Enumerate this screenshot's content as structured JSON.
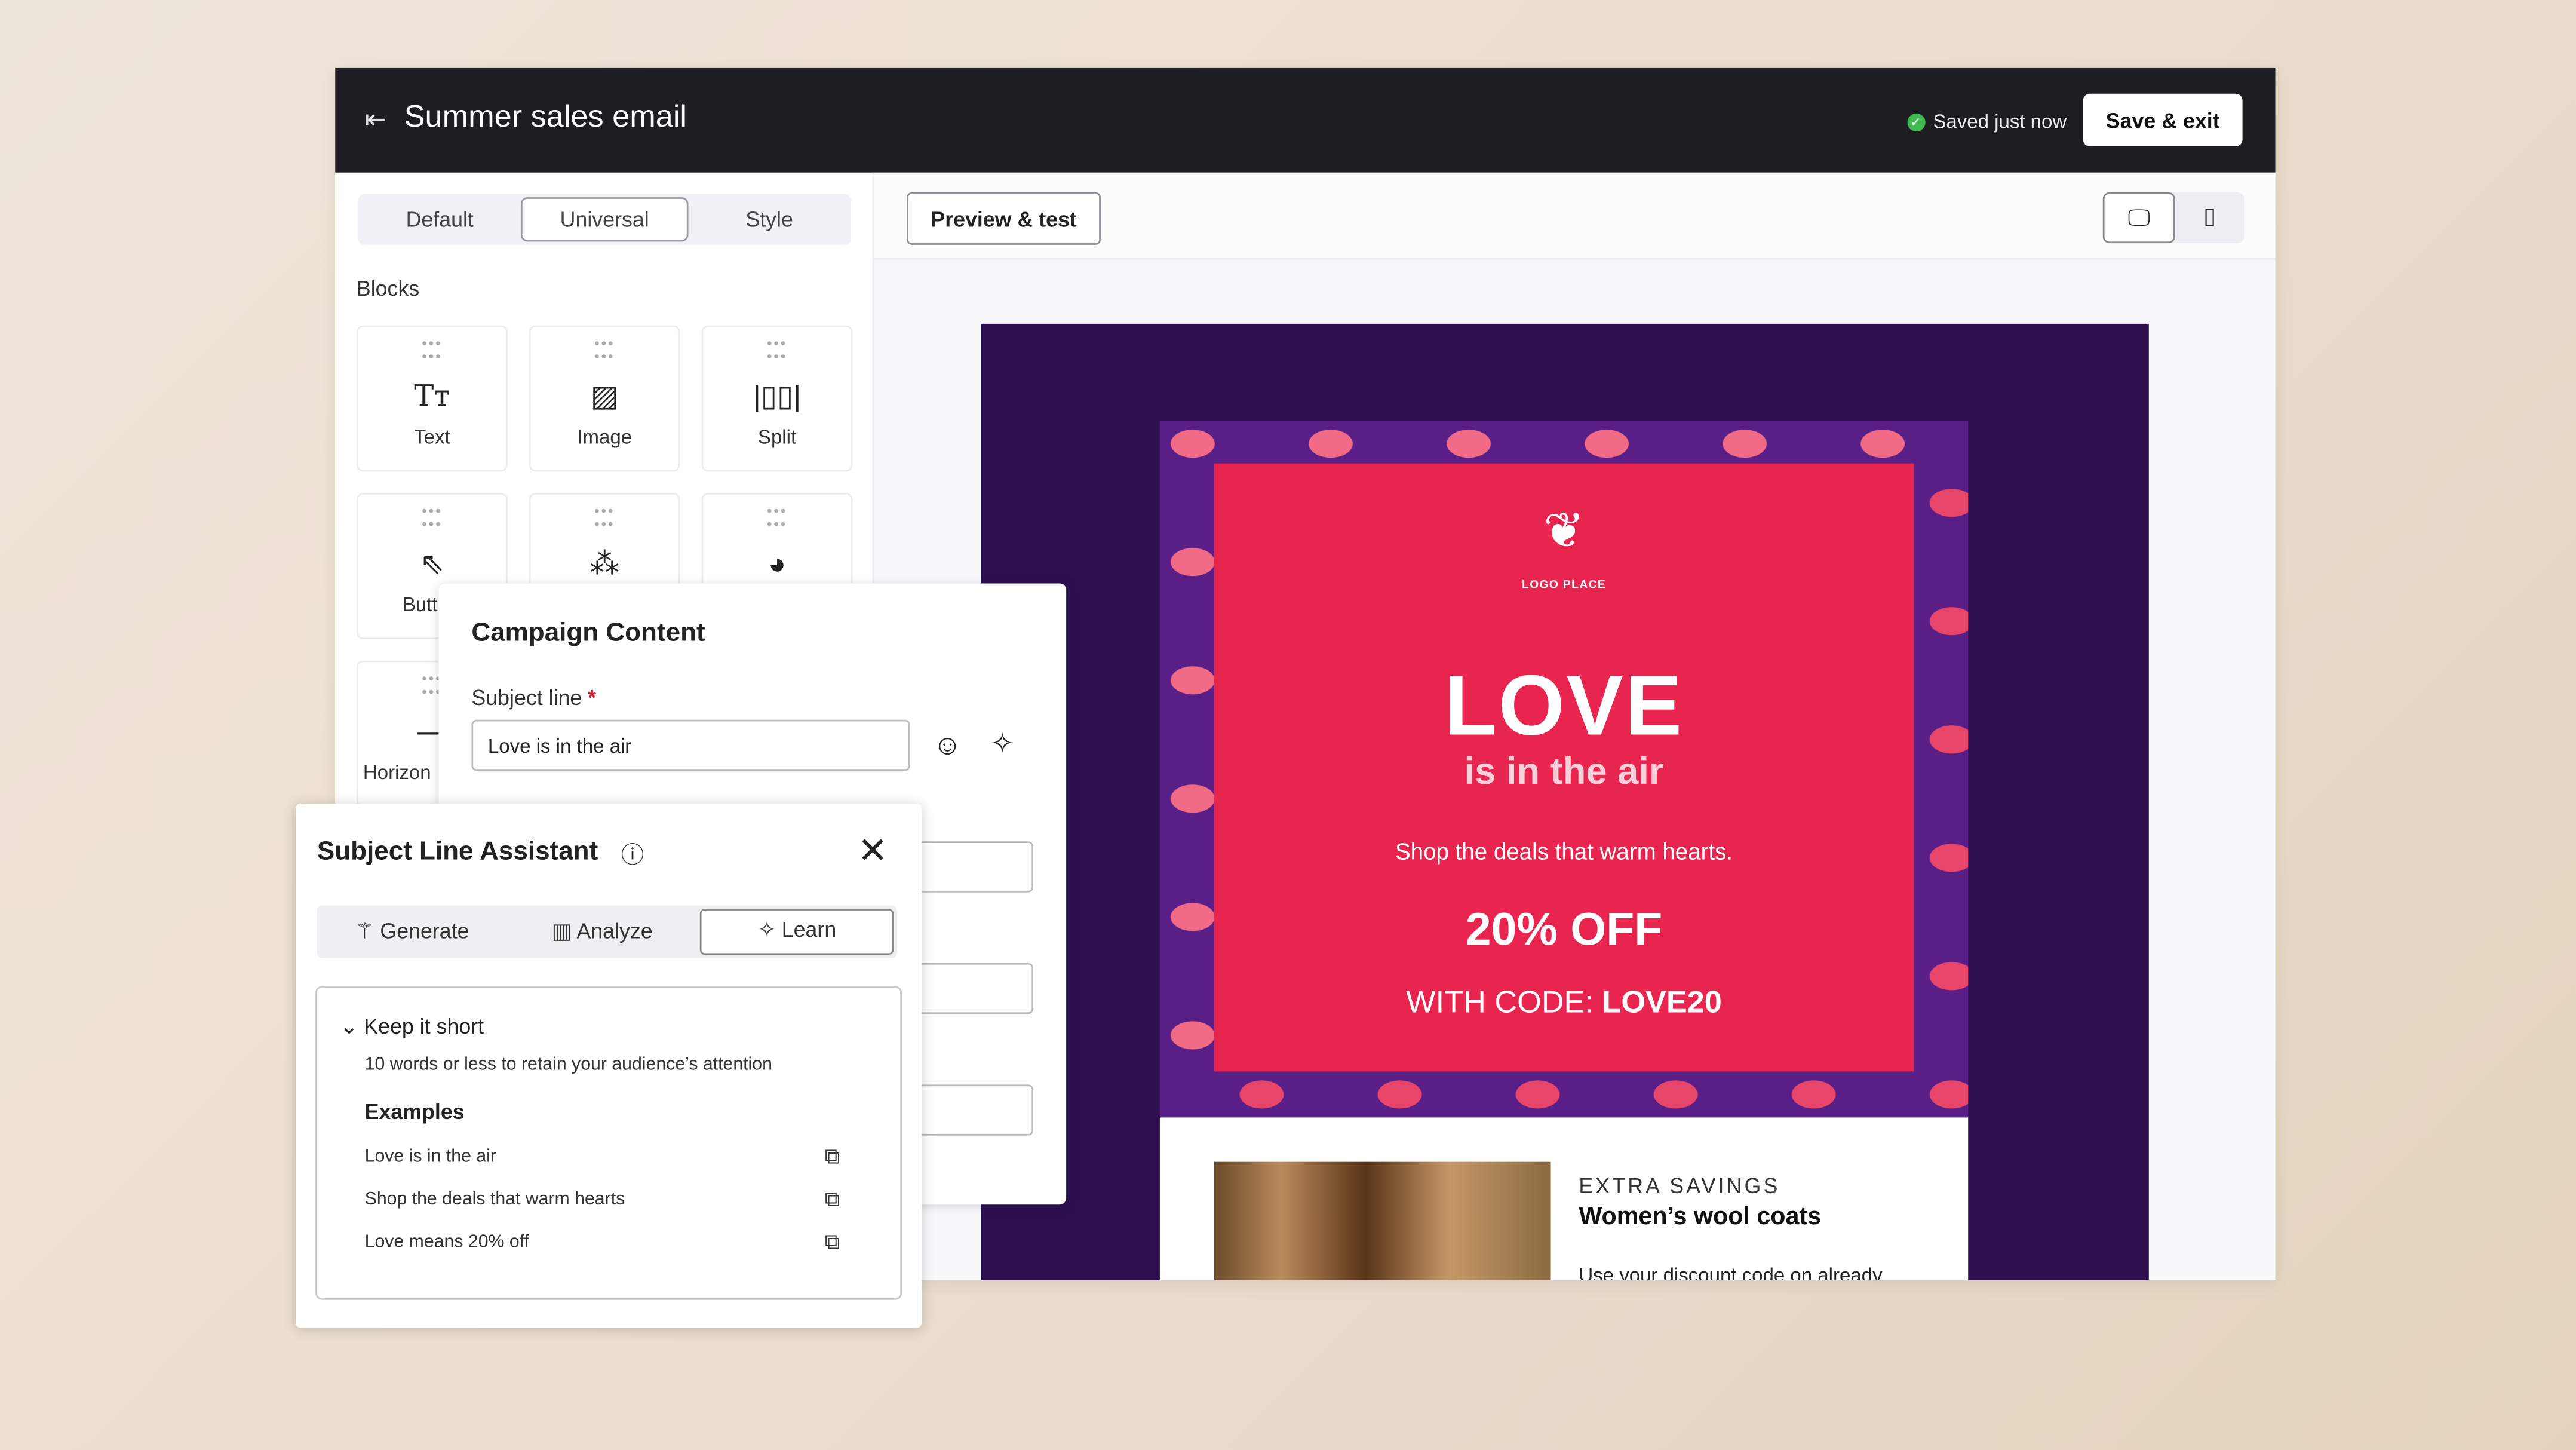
{
  "header": {
    "title": "Summer sales email",
    "status": "Saved just now",
    "save_exit": "Save & exit"
  },
  "left": {
    "tabs": [
      "Default",
      "Universal",
      "Style"
    ],
    "active_tab": "Universal",
    "blocks_label": "Blocks",
    "blocks": [
      {
        "label": "Text",
        "icon": "text-icon"
      },
      {
        "label": "Image",
        "icon": "image-icon"
      },
      {
        "label": "Split",
        "icon": "split-icon"
      },
      {
        "label": "Butt",
        "icon": "button-click-icon"
      },
      {
        "label": "",
        "icon": "social-icon"
      },
      {
        "label": "",
        "icon": "product-icon"
      },
      {
        "label": "Horizon",
        "icon": "horizontal-rule-icon"
      }
    ]
  },
  "toolbar": {
    "preview": "Preview & test",
    "devices": [
      "desktop",
      "mobile"
    ],
    "active_device": "desktop"
  },
  "email": {
    "logo_text": "LOGO PLACE",
    "headline": "LOVE",
    "subhead": "is in the air",
    "tagline": "Shop the deals that warm hearts.",
    "offer": "20% OFF",
    "code_prefix": "WITH CODE: ",
    "code": "LOVE20",
    "extra": "EXTRA SAVINGS",
    "product": "Women’s wool coats",
    "body": "Use your discount code on already",
    "colors": {
      "background": "#2d0f50",
      "card": "#e8254f"
    }
  },
  "campaign": {
    "title": "Campaign Content",
    "subject_label": "Subject line",
    "required": "*",
    "subject_value": "Love is in the air"
  },
  "assistant": {
    "title": "Subject Line Assistant",
    "tabs": [
      "Generate",
      "Analyze",
      "Learn"
    ],
    "active_tab": "Learn",
    "tip_title": "Keep it short",
    "tip_desc": "10 words or less to retain your audience’s attention",
    "examples_label": "Examples",
    "examples": [
      "Love is in the air",
      "Shop the deals that warm hearts",
      "Love means 20% off"
    ]
  }
}
